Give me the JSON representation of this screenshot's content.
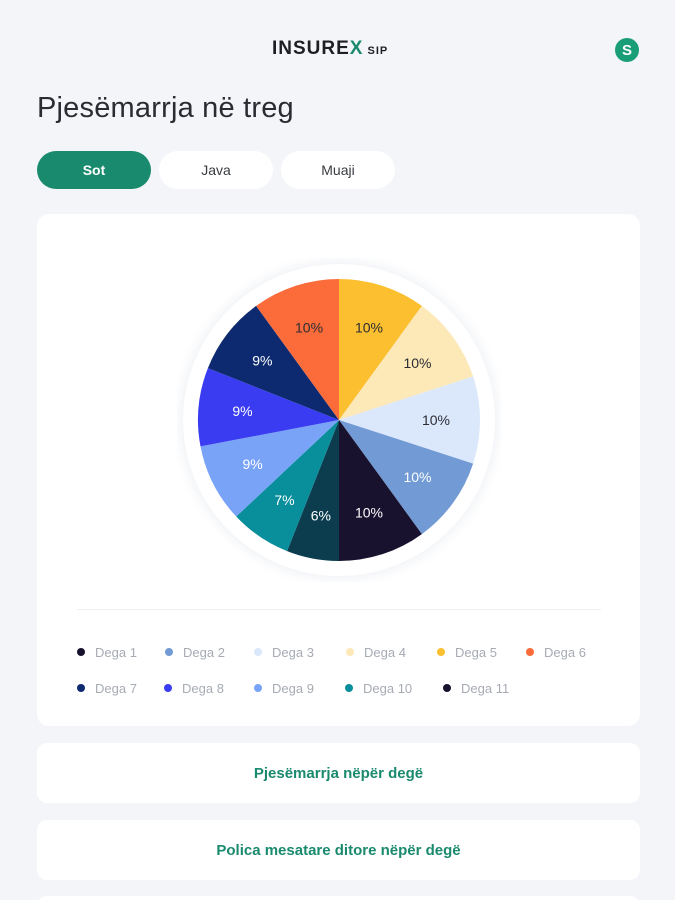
{
  "header": {
    "logo_main": "INSURE",
    "logo_accent": "X",
    "logo_sub": "SIP",
    "avatar_letter": "S"
  },
  "page_title": "Pjesëmarrja në treg",
  "tabs": [
    {
      "label": "Sot",
      "active": true
    },
    {
      "label": "Java",
      "active": false
    },
    {
      "label": "Muaji",
      "active": false
    }
  ],
  "chart_data": {
    "type": "pie",
    "slices": [
      {
        "label": "Dega 5",
        "value": 10,
        "text": "10%",
        "color": "#fbbf2f",
        "text_color": "#2b2d33"
      },
      {
        "label": "Dega 4",
        "value": 10,
        "text": "10%",
        "color": "#fde8b8",
        "text_color": "#2b2d33"
      },
      {
        "label": "Dega 3",
        "value": 10,
        "text": "10%",
        "color": "#dbe7fb",
        "text_color": "#2b2d33"
      },
      {
        "label": "Dega 2",
        "value": 10,
        "text": "10%",
        "color": "#729bd6",
        "text_color": "#ffffff"
      },
      {
        "label": "Dega 1",
        "value": 10,
        "text": "10%",
        "color": "#18122e",
        "text_color": "#ffffff"
      },
      {
        "label": "Dega 11",
        "value": 6,
        "text": "6%",
        "color": "#0b3d4f",
        "text_color": "#ffffff"
      },
      {
        "label": "Dega 10",
        "value": 7,
        "text": "7%",
        "color": "#098e9c",
        "text_color": "#ffffff"
      },
      {
        "label": "Dega 9",
        "value": 9,
        "text": "9%",
        "color": "#79a3f7",
        "text_color": "#ffffff"
      },
      {
        "label": "Dega 8",
        "value": 9,
        "text": "9%",
        "color": "#3a3cf2",
        "text_color": "#ffffff"
      },
      {
        "label": "Dega 7",
        "value": 9,
        "text": "9%",
        "color": "#0d2a70",
        "text_color": "#ffffff"
      },
      {
        "label": "Dega 6",
        "value": 10,
        "text": "10%",
        "color": "#fc6b3a",
        "text_color": "#2b2d33"
      }
    ],
    "legend": [
      [
        {
          "label": "Dega 1",
          "color": "#18122e"
        },
        {
          "label": "Dega 2",
          "color": "#729bd6"
        },
        {
          "label": "Dega 3",
          "color": "#dbe7fb"
        },
        {
          "label": "Dega 4",
          "color": "#fde8b8"
        },
        {
          "label": "Dega 5",
          "color": "#fbbf2f"
        },
        {
          "label": "Dega 6",
          "color": "#fc6b3a"
        }
      ],
      [
        {
          "label": "Dega 7",
          "color": "#0d2a70"
        },
        {
          "label": "Dega 8",
          "color": "#3a3cf2"
        },
        {
          "label": "Dega 9",
          "color": "#79a3f7"
        },
        {
          "label": "Dega 10",
          "color": "#098e9c"
        },
        {
          "label": "Dega 11",
          "color": "#18122e"
        }
      ]
    ]
  },
  "links": [
    {
      "label": "Pjesëmarrja nëpër degë"
    },
    {
      "label": "Polica mesatare ditore nëpër degë"
    }
  ],
  "colors": {
    "accent": "#1a8a6e",
    "background": "#f4f5f8"
  }
}
